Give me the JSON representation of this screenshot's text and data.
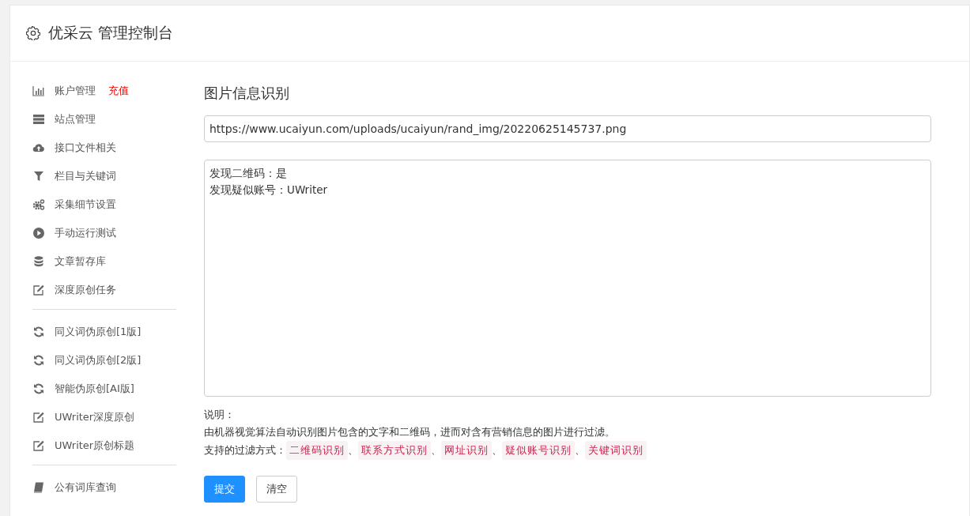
{
  "header": {
    "title": "优采云 管理控制台"
  },
  "sidebar": {
    "groups": [
      {
        "items": [
          {
            "label": "账户管理",
            "badge": "充值",
            "kind": "chart"
          },
          {
            "label": "站点管理",
            "kind": "server"
          },
          {
            "label": "接口文件相关",
            "kind": "cloud"
          },
          {
            "label": "栏目与关键词",
            "kind": "filter"
          },
          {
            "label": "采集细节设置",
            "kind": "gears"
          },
          {
            "label": "手动运行测试",
            "kind": "play"
          },
          {
            "label": "文章暂存库",
            "kind": "database"
          },
          {
            "label": "深度原创任务",
            "kind": "edit"
          }
        ]
      },
      {
        "items": [
          {
            "label": "同义词伪原创[1版]",
            "kind": "refresh"
          },
          {
            "label": "同义词伪原创[2版]",
            "kind": "refresh"
          },
          {
            "label": "智能伪原创[AI版]",
            "kind": "refresh"
          },
          {
            "label": "UWriter深度原创",
            "kind": "edit"
          },
          {
            "label": "UWriter原创标题",
            "kind": "edit"
          }
        ]
      },
      {
        "items": [
          {
            "label": "公有词库查询",
            "kind": "book"
          }
        ]
      }
    ]
  },
  "main": {
    "title": "图片信息识别",
    "url_field": {
      "value": "https://www.ucaiyun.com/uploads/ucaiyun/rand_img/20220625145737.png"
    },
    "result_lines": [
      "发现二维码：是",
      "发现疑似账号：UWriter"
    ],
    "note_label": "说明：",
    "note_text": "由机器视觉算法自动识别图片包含的文字和二维码，进而对含有营销信息的图片进行过滤。",
    "methods_label": "支持的过滤方式：",
    "methods": [
      "二维码识别",
      "联系方式识别",
      "网址识别",
      "疑似账号识别",
      "关键词识别"
    ],
    "separator": "、",
    "buttons": [
      {
        "label": "提交",
        "kind": "primary"
      },
      {
        "label": "清空",
        "kind": "default"
      }
    ]
  }
}
